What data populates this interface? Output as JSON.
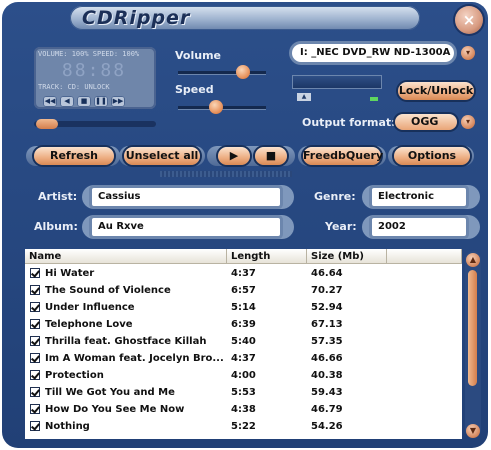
{
  "app": {
    "title": "CDRipper",
    "close_glyph": "×"
  },
  "lcd": {
    "line1": "VOLUME: 100%  SPEED: 100%",
    "digits": "88:88",
    "line2": "TRACK:       CD: UNLOCK",
    "transport": [
      "◀◀",
      "◀",
      "■",
      "❚❚",
      "▶▶"
    ]
  },
  "labels": {
    "volume": "Volume",
    "speed": "Speed",
    "output_format": "Output format:"
  },
  "levels": {
    "volume": 0.78,
    "speed": 0.42,
    "seek": 0.0
  },
  "drive": {
    "value": "I: _NEC DVD_RW ND-1300A 1",
    "dropdown_glyph": "▾"
  },
  "buttons": {
    "lock_unlock": "Lock/Unlock",
    "refresh": "Refresh",
    "unselect_all": "Unselect all",
    "play": "▶",
    "stop": "■",
    "freedb": "FreedbQuery",
    "options": "Options"
  },
  "output_format": {
    "value": "OGG"
  },
  "fields": {
    "artist_label": "Artist:",
    "artist": "Cassius",
    "album_label": "Album:",
    "album": "Au Rxve",
    "genre_label": "Genre:",
    "genre": "Electronic",
    "year_label": "Year:",
    "year": "2002"
  },
  "table": {
    "columns": [
      "Name",
      "Length",
      "Size (Mb)",
      ""
    ],
    "rows": [
      {
        "name": "Hi Water",
        "length": "4:37",
        "size": "46.64"
      },
      {
        "name": "The Sound of Violence",
        "length": "6:57",
        "size": "70.27"
      },
      {
        "name": "Under Influence",
        "length": "5:14",
        "size": "52.94"
      },
      {
        "name": "Telephone Love",
        "length": "6:39",
        "size": "67.13"
      },
      {
        "name": "Thrilla feat. Ghostface Killah",
        "length": "5:40",
        "size": "57.35"
      },
      {
        "name": "Im A Woman feat. Jocelyn Bro...",
        "length": "4:37",
        "size": "46.66"
      },
      {
        "name": "Protection",
        "length": "4:00",
        "size": "40.38"
      },
      {
        "name": "Till We Got You and Me",
        "length": "5:53",
        "size": "59.43"
      },
      {
        "name": "How Do You See Me Now",
        "length": "4:38",
        "size": "46.79"
      },
      {
        "name": "Nothing",
        "length": "5:22",
        "size": "54.26"
      }
    ]
  },
  "scrollbar": {
    "up": "▲",
    "down": "▼"
  }
}
